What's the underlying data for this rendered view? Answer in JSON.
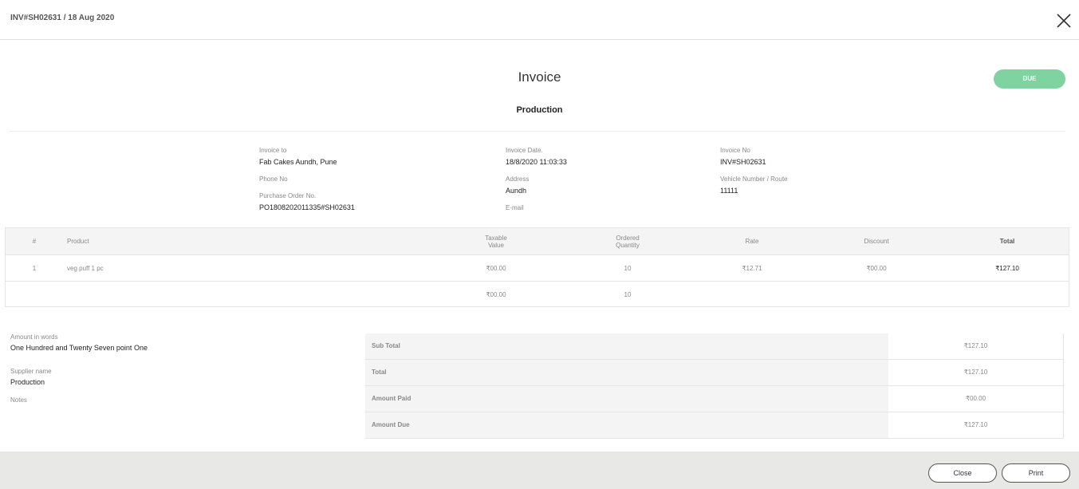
{
  "header": {
    "title": "INV#SH02631 / 18 Aug 2020",
    "close_icon": "close-icon"
  },
  "document": {
    "title": "Invoice",
    "status": "DUE",
    "organization": "Production",
    "status_color": "#7fd3a0"
  },
  "details": {
    "invoice_to_label": "Invoice to",
    "invoice_to": "Fab Cakes Aundh, Pune",
    "phone_label": "Phone No",
    "po_label": "Purchase Order No.",
    "po": "PO1808202011335#SH02631",
    "date_label": "Invoice Date.",
    "date": "18/8/2020 11:03:33",
    "address_label": "Address",
    "address": "Aundh",
    "email_label": "E-mail",
    "invoice_no_label": "Invoice No",
    "invoice_no": "INV#SH02631",
    "vehicle_label": "Vehicle Number / Route",
    "vehicle": "11111"
  },
  "table": {
    "headers": {
      "num": "#",
      "product": "Product",
      "taxable_1": "Taxable",
      "taxable_2": "Value",
      "ordered_1": "Ordered",
      "ordered_2": "Quantity",
      "rate": "Rate",
      "discount": "Discount",
      "total": "Total"
    },
    "rows": [
      {
        "num": "1",
        "product": "veg puff 1 pc",
        "taxable": "₹00.00",
        "qty": "10",
        "rate": "₹12.71",
        "discount": "₹00.00",
        "total": "₹127.10"
      }
    ],
    "totals": {
      "taxable": "₹00.00",
      "qty": "10"
    }
  },
  "words": {
    "amount_label": "Amount in words",
    "amount": "One Hundred and Twenty Seven point One",
    "supplier_label": "Supplier name",
    "supplier": "Production",
    "notes_label": "Notes"
  },
  "summary": [
    {
      "label": "Sub Total",
      "value": "₹127.10"
    },
    {
      "label": "Total",
      "value": "₹127.10"
    },
    {
      "label": "Amount Paid",
      "value": "₹00.00"
    },
    {
      "label": "Amount Due",
      "value": "₹127.10"
    }
  ],
  "footer": {
    "close_label": "Close",
    "print_label": "Print"
  }
}
